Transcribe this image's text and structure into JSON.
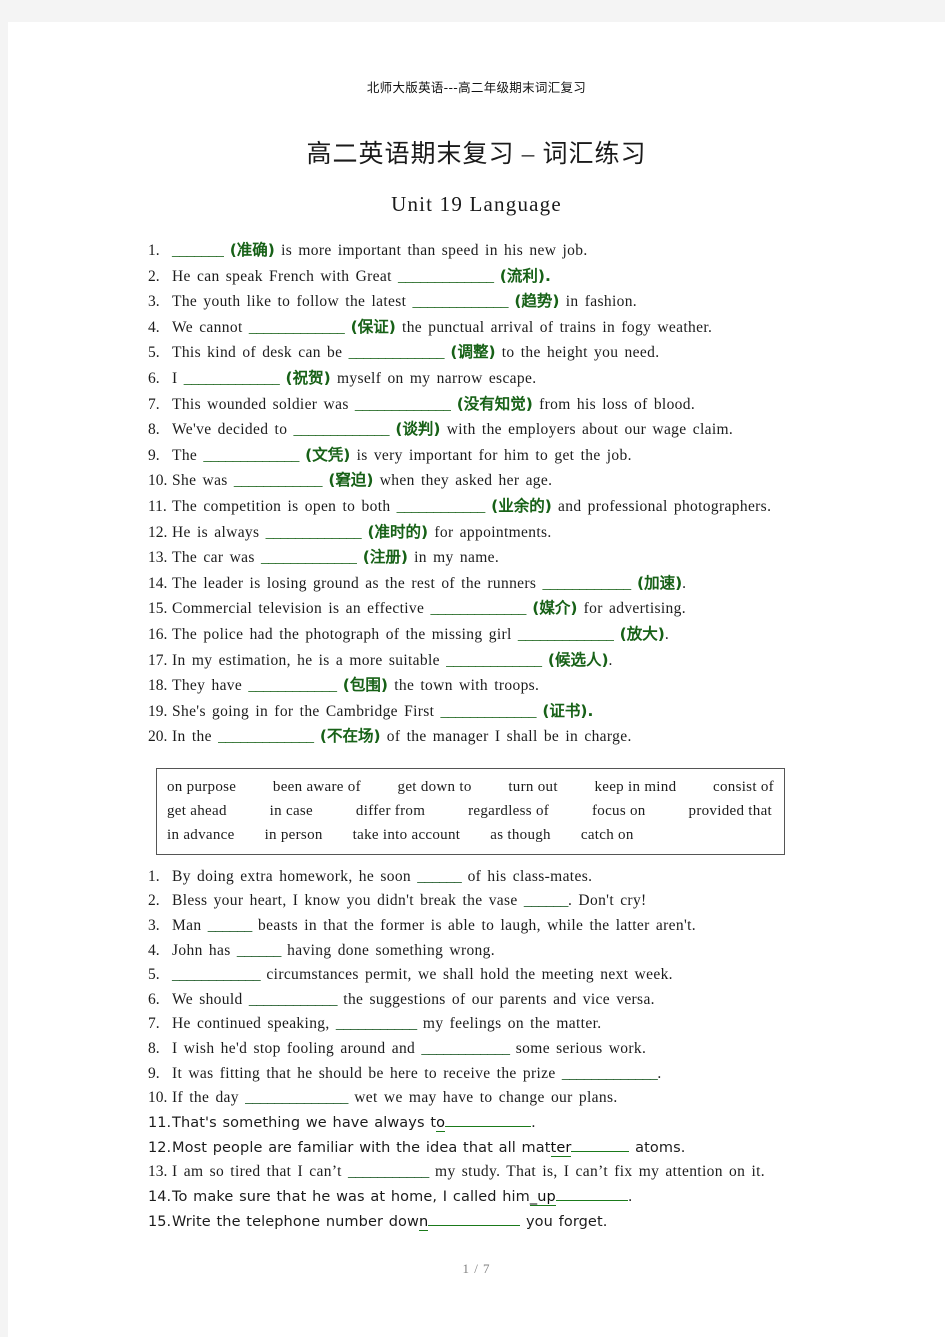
{
  "document": {
    "running_header": "北师大版英语---高二年级期末词汇复习",
    "title": "高二英语期末复习 – 词汇练习",
    "subtitle": "Unit 19 Language",
    "footer": "1 / 7",
    "accent_green": "#176117",
    "underline_green": "#1a7a1a",
    "text_color": "#1c1c1c"
  },
  "section_a": {
    "items": [
      {
        "num": "1.",
        "pre": "",
        "blank": "_______",
        "hint": "(准确)",
        "post": " is more important than speed in his new job."
      },
      {
        "num": "2.",
        "pre": "He can speak French with Great ",
        "blank": "_____________",
        "hint": "(流利).",
        "post": ""
      },
      {
        "num": "3.",
        "pre": "The youth like to follow the latest ",
        "blank": "_____________",
        "hint": "(趋势)",
        "post": " in fashion."
      },
      {
        "num": "4.",
        "pre": "We cannot ",
        "blank": "_____________",
        "hint": "(保证)",
        "post": " the punctual arrival of trains in fogy weather."
      },
      {
        "num": "5.",
        "pre": "This kind of desk can be ",
        "blank": "_____________",
        "hint": "(调整)",
        "post": " to the height you need."
      },
      {
        "num": "6.",
        "pre": "I ",
        "blank": "_____________",
        "hint": "(祝贺)",
        "post": " myself on my narrow escape."
      },
      {
        "num": "7.",
        "pre": "This wounded soldier was ",
        "blank": "_____________",
        "hint": "(没有知觉)",
        "post": " from his loss of blood."
      },
      {
        "num": "8.",
        "pre": "We've decided to ",
        "blank": "_____________",
        "hint": "(谈判)",
        "post": " with the employers about our wage claim."
      },
      {
        "num": "9.",
        "pre": "The ",
        "blank": "_____________",
        "hint": "(文凭)",
        "post": " is very important for him to get the job."
      },
      {
        "num": "10.",
        "pre": "She was ",
        "blank": "____________",
        "hint": "(窘迫)",
        "post": " when they asked her age."
      },
      {
        "num": "11.",
        "pre": "The competition is open to both ",
        "blank": "____________",
        "hint": "(业余的)",
        "post": " and professional photographers."
      },
      {
        "num": "12.",
        "pre": "He is always ",
        "blank": "_____________",
        "hint": "(准时的)",
        "post": " for appointments."
      },
      {
        "num": "13.",
        "pre": "The car was ",
        "blank": "_____________",
        "hint": "(注册)",
        "post": " in my name."
      },
      {
        "num": "14.",
        "pre": "The leader is losing ground as the rest of the runners ",
        "blank": "____________",
        "hint": "(加速)",
        "post": "."
      },
      {
        "num": "15.",
        "pre": "Commercial television is an effective ",
        "blank": "_____________",
        "hint": "(媒介)",
        "post": " for advertising."
      },
      {
        "num": "16.",
        "pre": "The police had the photograph of the missing girl ",
        "blank": "_____________",
        "hint": "(放大)",
        "post": "."
      },
      {
        "num": "17.",
        "pre": "In my estimation, he is a more suitable ",
        "blank": "_____________",
        "hint": "(候选人)",
        "post": "."
      },
      {
        "num": "18.",
        "pre": "They have ",
        "blank": "____________",
        "hint": "(包围)",
        "post": " the town with troops."
      },
      {
        "num": "19.",
        "pre": "She's going in for the Cambridge First ",
        "blank": "_____________",
        "hint": "(证书).",
        "post": ""
      },
      {
        "num": "20.",
        "pre": "In the ",
        "blank": "_____________",
        "hint": "(不在场)",
        "post": " of the manager I shall be in charge."
      }
    ]
  },
  "phrase_box": {
    "line1": [
      "on purpose",
      "been aware of",
      "get down to",
      "turn out",
      "keep in mind",
      "consist of"
    ],
    "line2": [
      "get ahead",
      "in case",
      "differ from",
      "regardless of",
      "focus on",
      "provided that"
    ],
    "line3": [
      "in advance",
      "in person",
      "take into account",
      "as though",
      "catch on"
    ]
  },
  "section_b": {
    "items": [
      {
        "num": "1.",
        "style": "serif",
        "pre": "By doing extra homework, he soon ",
        "blank": "______",
        "post": " of his class-mates."
      },
      {
        "num": "2.",
        "style": "serif",
        "pre": "Bless your heart, I know you didn't break the vase ",
        "blank": "______",
        "post": ". Don't cry!"
      },
      {
        "num": "3.",
        "style": "serif",
        "pre": "Man ",
        "blank": "______",
        "post": " beasts in that the former is able to laugh, while the latter aren't."
      },
      {
        "num": "4.",
        "style": "serif",
        "pre": "John has ",
        "blank": "______",
        "post": " having done something wrong."
      },
      {
        "num": "5.",
        "style": "serif",
        "pre": "",
        "blank": "____________",
        "post": " circumstances permit, we shall hold the meeting next week."
      },
      {
        "num": "6.",
        "style": "serif",
        "pre": "We should ",
        "blank": "____________",
        "post": " the suggestions of our parents and vice versa."
      },
      {
        "num": "7.",
        "style": "serif",
        "pre": "He continued speaking, ",
        "blank": "___________",
        "post": " my feelings on the matter."
      },
      {
        "num": "8.",
        "style": "serif",
        "pre": "I wish he'd stop fooling around and ",
        "blank": "____________",
        "post": " some serious work."
      },
      {
        "num": "9.",
        "style": "serif",
        "pre": "It was fitting that he should be here to receive the prize ",
        "blank": "_____________",
        "post": "."
      },
      {
        "num": "10.",
        "style": "serif",
        "pre": "If the day ",
        "blank": "______________",
        "post": " wet we may have to change our plans."
      },
      {
        "num": "11.",
        "style": "sans-underline",
        "pre": "That's something we have always t",
        "underlined": "o",
        "blankwidth": 86,
        "post": "."
      },
      {
        "num": "12.",
        "style": "sans-underline",
        "pre": "Most people are familiar with the idea that all mat",
        "underlined": "ter",
        "blankwidth": 58,
        "post": " atoms."
      },
      {
        "num": "13.",
        "style": "serif",
        "pre": "I am so tired that I can’t ",
        "blank": "___________",
        "post": " my study. That is, I can’t fix my attention on it."
      },
      {
        "num": "14.",
        "style": "sans-underline",
        "pre": "To make sure that he was at home, I called him",
        "underlined": "_up",
        "blankwidth": 72,
        "post": "."
      },
      {
        "num": "15.",
        "style": "sans-underline",
        "pre": "Write the telephone number dow",
        "underlined": "n",
        "blankwidth": 92,
        "post": " you forget."
      }
    ]
  }
}
